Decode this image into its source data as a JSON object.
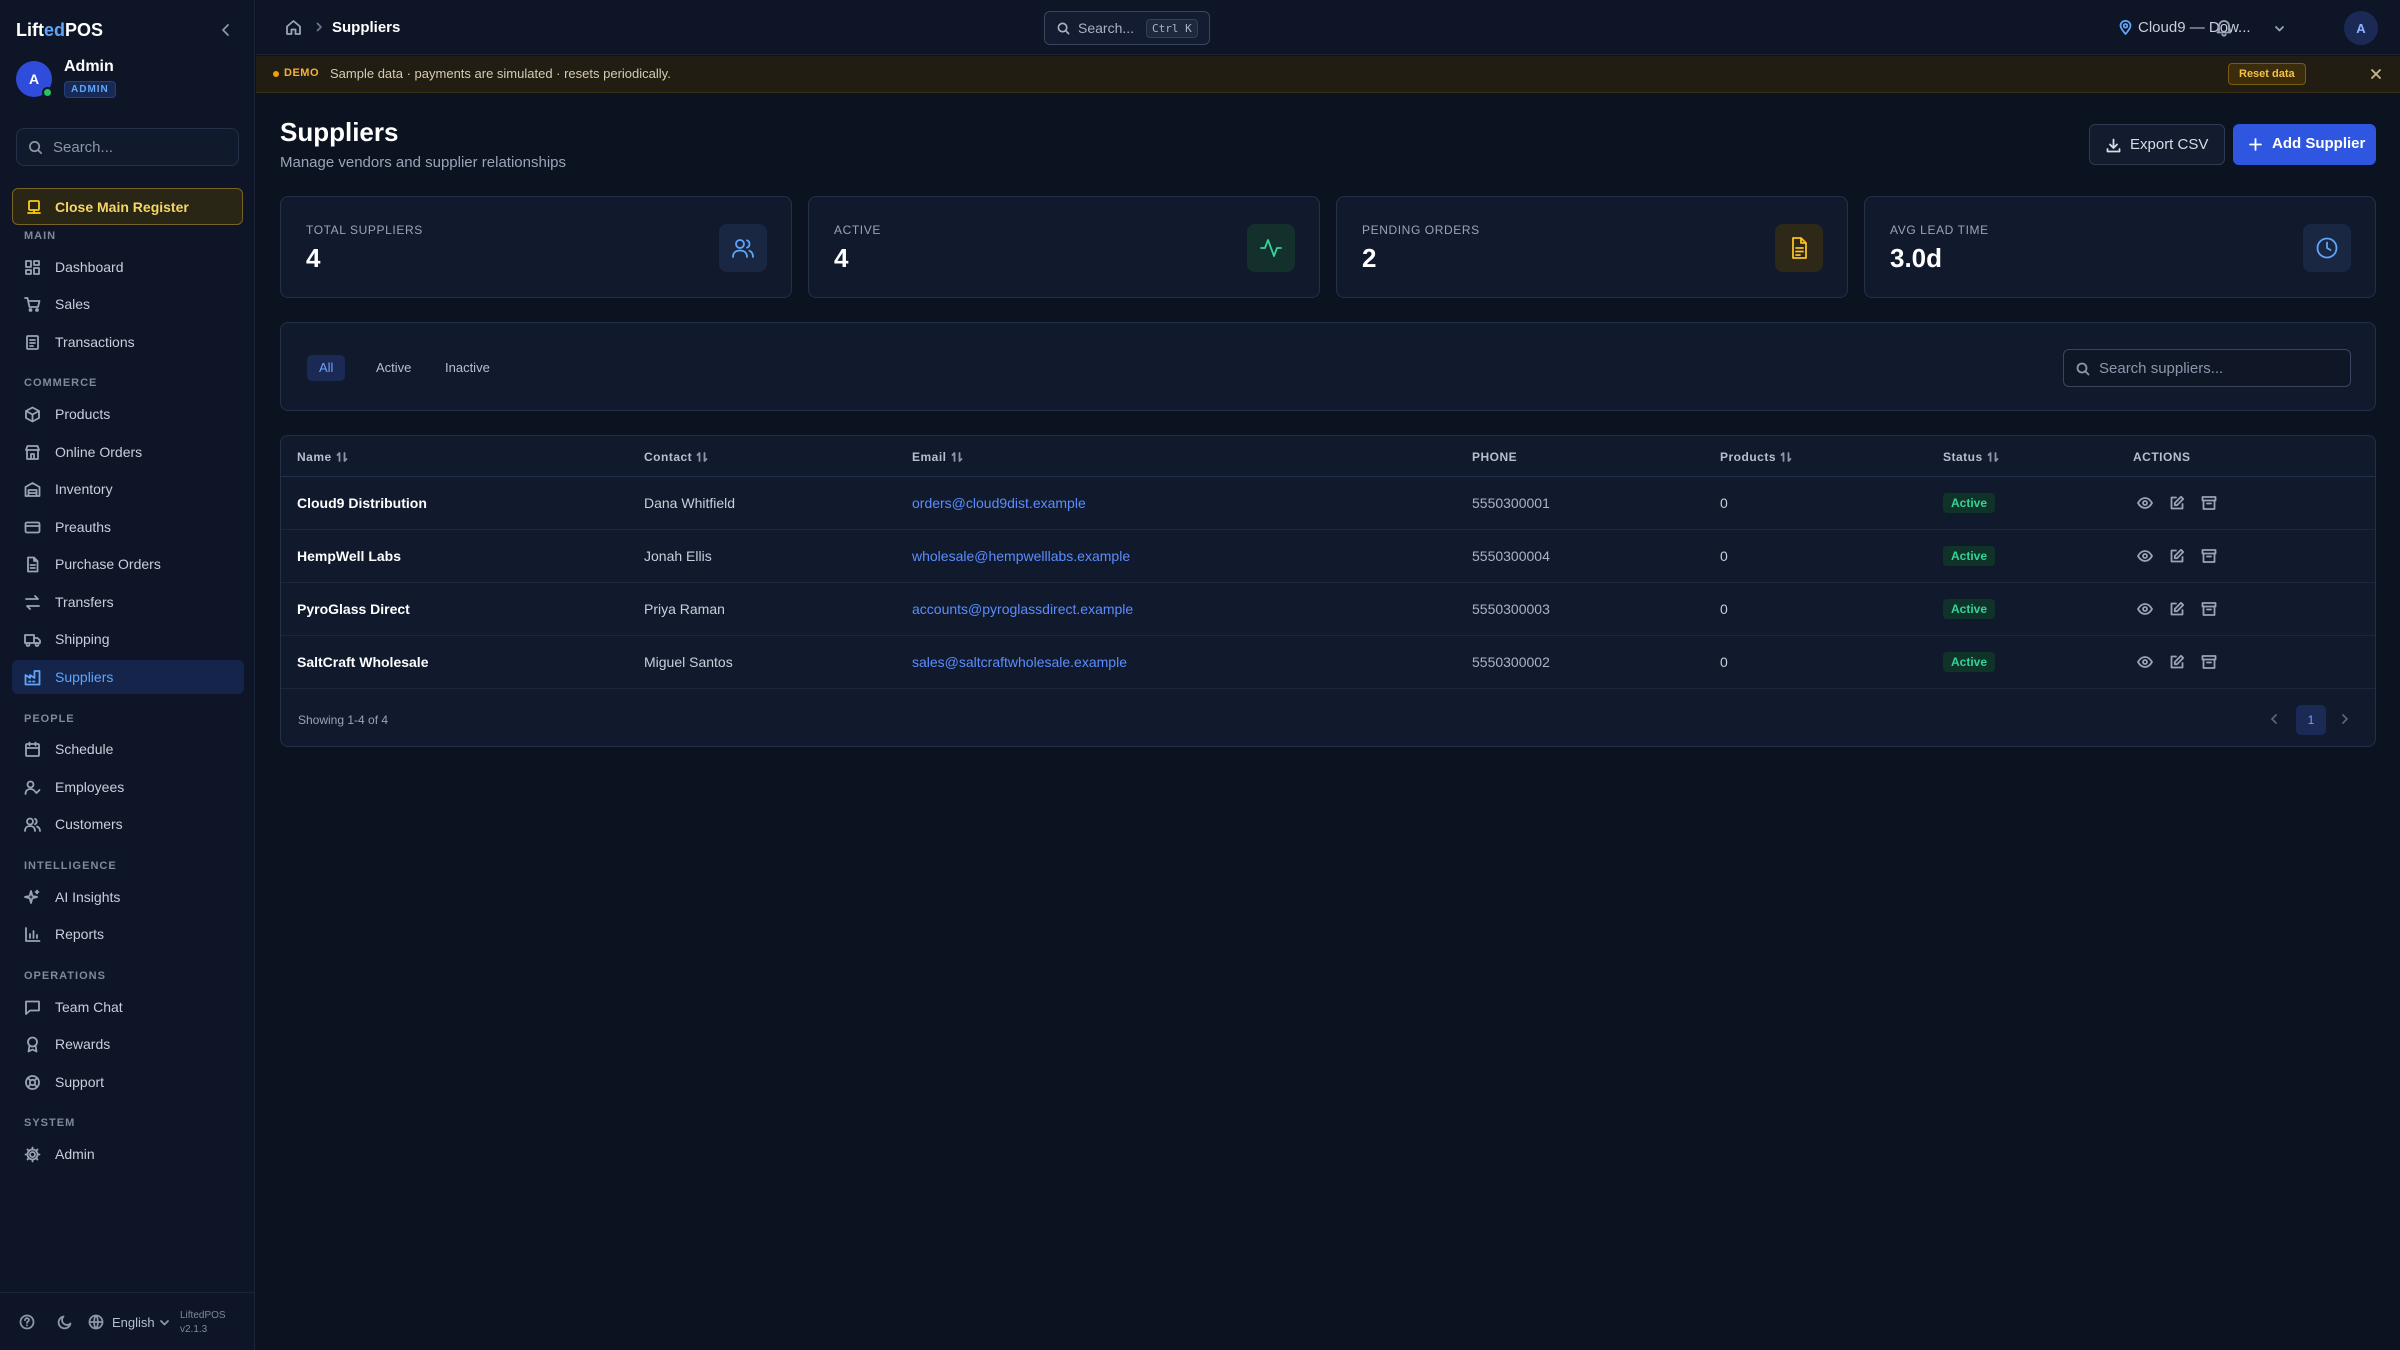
{
  "brand": {
    "prefix": "Lift",
    "highlight": "ed",
    "suffix": "POS"
  },
  "user": {
    "initial": "A",
    "name": "Admin",
    "role": "ADMIN"
  },
  "sidebar": {
    "search_placeholder": "Search...",
    "register_label": "Close Main Register",
    "sections": {
      "main": "MAIN",
      "commerce": "COMMERCE",
      "people": "PEOPLE",
      "intelligence": "INTELLIGENCE",
      "operations": "OPERATIONS",
      "system": "SYSTEM"
    },
    "items": {
      "dashboard": "Dashboard",
      "sales": "Sales",
      "transactions": "Transactions",
      "products": "Products",
      "online_orders": "Online Orders",
      "inventory": "Inventory",
      "preauths": "Preauths",
      "purchase_orders": "Purchase Orders",
      "transfers": "Transfers",
      "shipping": "Shipping",
      "suppliers": "Suppliers",
      "schedule": "Schedule",
      "employees": "Employees",
      "customers": "Customers",
      "ai_insights": "AI Insights",
      "reports": "Reports",
      "team_chat": "Team Chat",
      "rewards": "Rewards",
      "support": "Support",
      "admin": "Admin"
    },
    "active": "suppliers",
    "footer": {
      "language": "English",
      "app_name": "LiftedPOS",
      "version": "v2.1.3"
    }
  },
  "topbar": {
    "breadcrumb": "Suppliers",
    "search_placeholder": "Search...",
    "shortcut": "Ctrl K",
    "location": "Cloud9 — Dow...",
    "avatar_initial": "A"
  },
  "banner": {
    "tag": "DEMO",
    "message": "Sample data · payments are simulated · resets periodically.",
    "reset_label": "Reset data"
  },
  "page": {
    "title": "Suppliers",
    "subtitle": "Manage vendors and supplier relationships",
    "export_label": "Export CSV",
    "add_label": "Add Supplier"
  },
  "stats": [
    {
      "label": "TOTAL SUPPLIERS",
      "value": "4",
      "icon": "users-icon",
      "color": "#60a5fa"
    },
    {
      "label": "ACTIVE",
      "value": "4",
      "icon": "activity-icon",
      "color": "#34d399"
    },
    {
      "label": "PENDING ORDERS",
      "value": "2",
      "icon": "document-icon",
      "color": "#fbbf24"
    },
    {
      "label": "AVG LEAD TIME",
      "value": "3.0d",
      "icon": "clock-icon",
      "color": "#60a5fa"
    }
  ],
  "filters": {
    "tabs": [
      "All",
      "Active",
      "Inactive"
    ],
    "active_tab": "All",
    "search_placeholder": "Search suppliers..."
  },
  "table": {
    "columns": [
      "Name",
      "Contact",
      "Email",
      "PHONE",
      "Products",
      "Status",
      "ACTIONS"
    ],
    "rows": [
      {
        "name": "Cloud9 Distribution",
        "contact": "Dana Whitfield",
        "email": "orders@cloud9dist.example",
        "phone": "5550300001",
        "products": "0",
        "status": "Active"
      },
      {
        "name": "HempWell Labs",
        "contact": "Jonah Ellis",
        "email": "wholesale@hempwelllabs.example",
        "phone": "5550300004",
        "products": "0",
        "status": "Active"
      },
      {
        "name": "PyroGlass Direct",
        "contact": "Priya Raman",
        "email": "accounts@pyroglassdirect.example",
        "phone": "5550300003",
        "products": "0",
        "status": "Active"
      },
      {
        "name": "SaltCraft Wholesale",
        "contact": "Miguel Santos",
        "email": "sales@saltcraftwholesale.example",
        "phone": "5550300002",
        "products": "0",
        "status": "Active"
      }
    ],
    "showing": "Showing 1-4 of 4",
    "current_page": "1"
  },
  "colors": {
    "accent": "#2f56e0",
    "link": "#5b8cff",
    "success": "#34d399",
    "warning": "#facc15"
  }
}
